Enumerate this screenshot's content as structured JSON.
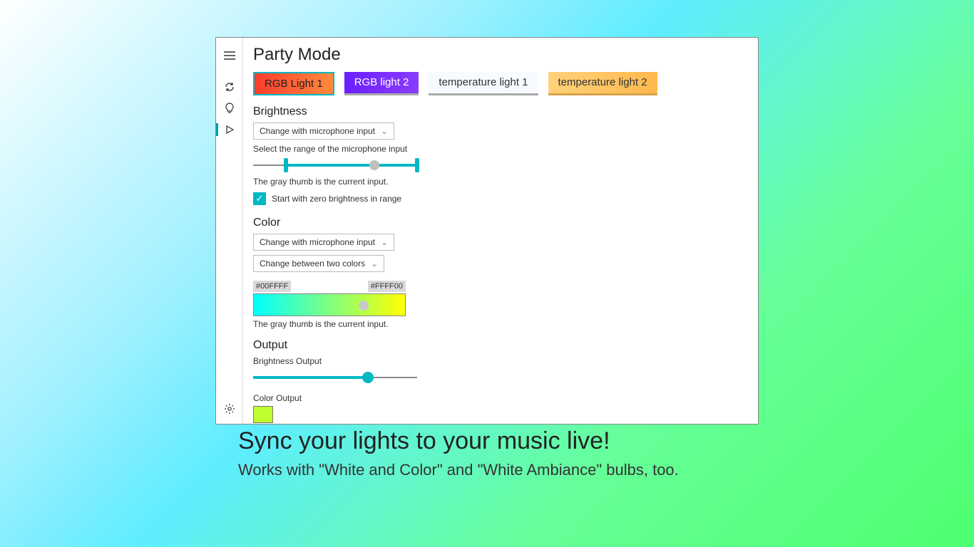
{
  "title": "Party Mode",
  "lights": [
    {
      "label": "RGB Light 1"
    },
    {
      "label": "RGB light 2"
    },
    {
      "label": "temperature light 1"
    },
    {
      "label": "temperature light 2"
    }
  ],
  "brightness": {
    "heading": "Brightness",
    "mode_dropdown": "Change with microphone input",
    "range_label": "Select the range of the microphone input",
    "range_lo_pct": 20,
    "range_hi_pct": 100,
    "current_pct": 74,
    "hint": "The gray thumb is the current input.",
    "zero_checkbox_label": "Start with zero brightness in range",
    "zero_checked": true
  },
  "color": {
    "heading": "Color",
    "mode_dropdown": "Change with microphone input",
    "transition_dropdown": "Change between two colors",
    "hex_from": "#00FFFF",
    "hex_to": "#FFFF00",
    "current_pct": 72,
    "hint": "The gray thumb is the current input."
  },
  "output": {
    "heading": "Output",
    "brightness_label": "Brightness Output",
    "brightness_pct": 70,
    "color_label": "Color Output",
    "color_swatch": "#bfff2e"
  },
  "promo": {
    "headline": "Sync your lights to your music live!",
    "sub": "Works with \"White and Color\" and \"White Ambiance\" bulbs, too."
  }
}
